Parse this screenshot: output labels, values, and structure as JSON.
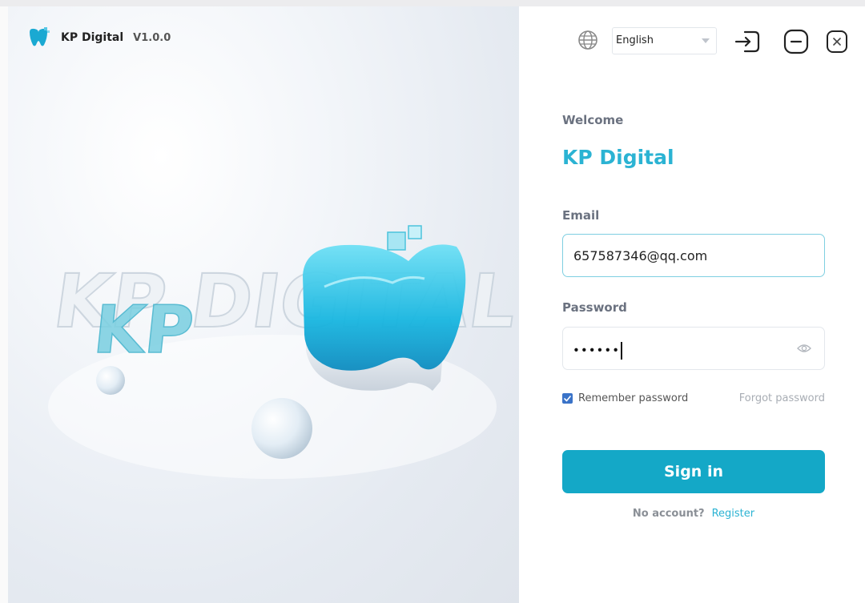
{
  "app": {
    "name": "KP Digital",
    "version": "V1.0.0",
    "hero_text": "KP DIGITAL"
  },
  "topbar": {
    "language": "English"
  },
  "login": {
    "greeting": "Welcome",
    "title": "KP Digital",
    "email_label": "Email",
    "email_value": "657587346@qq.com",
    "password_label": "Password",
    "password_mask": "••••••",
    "remember_label": "Remember password",
    "remember_checked": true,
    "forgot_label": "Forgot password",
    "signin_label": "Sign in",
    "no_account": "No account?",
    "register_label": "Register"
  },
  "colors": {
    "accent": "#14a8c7",
    "title": "#2bb3d3",
    "checkbox": "#3a73c8"
  },
  "icons": [
    "logo-icon",
    "globe-icon",
    "chevron-down-icon",
    "sign-in-icon",
    "minimize-icon",
    "close-icon",
    "eye-icon",
    "check-icon"
  ]
}
